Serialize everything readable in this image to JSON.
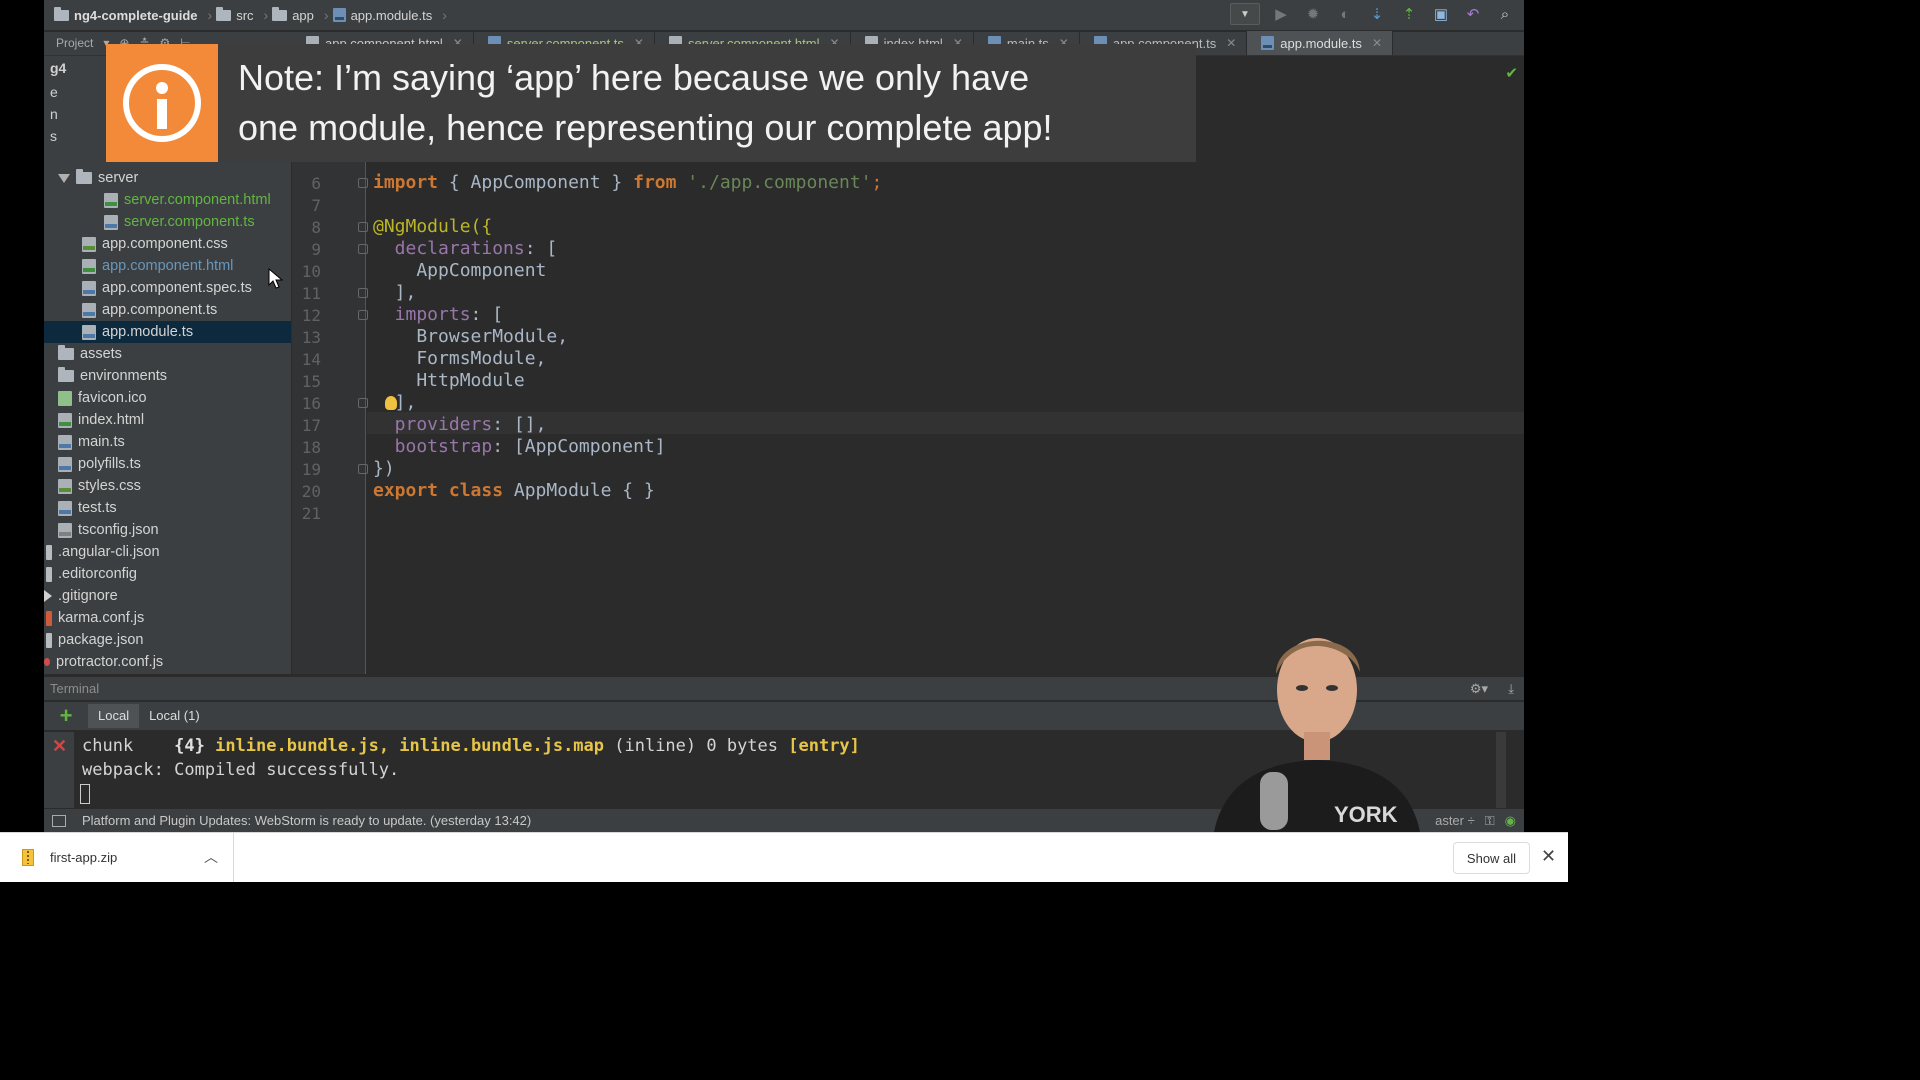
{
  "breadcrumb": {
    "items": [
      "ng4-complete-guide",
      "src",
      "app",
      "app.module.ts"
    ]
  },
  "project_panel": {
    "title": "Project"
  },
  "tabs": [
    {
      "label": "app.component.html",
      "active": false
    },
    {
      "label": "server.component.ts",
      "active": false
    },
    {
      "label": "server.component.html",
      "active": false
    },
    {
      "label": "index.html",
      "active": false
    },
    {
      "label": "main.ts",
      "active": false
    },
    {
      "label": "app.component.ts",
      "active": false
    },
    {
      "label": "app.module.ts",
      "active": true
    }
  ],
  "tree": {
    "server_folder": "server",
    "files": [
      "server.component.html",
      "server.component.ts",
      "app.component.css",
      "app.component.html",
      "app.component.spec.ts",
      "app.component.ts",
      "app.module.ts",
      "assets",
      "environments",
      "favicon.ico",
      "index.html",
      "main.ts",
      "polyfills.ts",
      "styles.css",
      "test.ts",
      "tsconfig.json",
      ".angular-cli.json",
      ".editorconfig",
      ".gitignore",
      "karma.conf.js",
      "package.json",
      "protractor.conf.js"
    ],
    "partial_root_label": "g4",
    "partial_letters": [
      "e",
      "n",
      "s"
    ]
  },
  "editor": {
    "line_numbers": [
      "6",
      "7",
      "8",
      "9",
      "10",
      "11",
      "12",
      "13",
      "14",
      "15",
      "16",
      "17",
      "18",
      "19",
      "20",
      "21"
    ],
    "code": {
      "l6_import": "import",
      "l6_mid": " { AppComponent } ",
      "l6_from": "from",
      "l6_str": " './app.component'",
      "l6_end": ";",
      "l8": "@NgModule({",
      "l9_prop": "  declarations",
      "l9_rest": ": [",
      "l10": "    AppComponent",
      "l11": "  ],",
      "l12_prop": "  imports",
      "l12_rest": ": [",
      "l13": "    BrowserModule,",
      "l14": "    FormsModule,",
      "l15": "    HttpModule",
      "l16": "  ],",
      "l17_prop": "  providers",
      "l17_rest": ": [],",
      "l18_prop": "  bootstrap",
      "l18_rest": ": [AppComponent]",
      "l19": "})",
      "l20_kw": "export class",
      "l20_rest": " AppModule { }"
    }
  },
  "note": {
    "text_line1": "Note: I’m saying ‘app’ here because we only have",
    "text_line2": "one module, hence representing our complete app!",
    "icon": "info-icon",
    "accent": "#f38a3a"
  },
  "terminal": {
    "title": "Terminal",
    "tabs": [
      "Local",
      "Local (1)"
    ],
    "line1_a": "chunk    ",
    "line1_b": "{4}",
    "line1_c": " inline.bundle.js, inline.bundle.js.map",
    "line1_d": " (inline) 0 bytes ",
    "line1_e": "[entry]",
    "line2": "webpack: Compiled successfully."
  },
  "status": {
    "message": "Platform and Plugin Updates: WebStorm is ready to update. (yesterday 13:42)",
    "branch": "aster ÷"
  },
  "downloads": {
    "file_name": "first-app.zip",
    "show_all": "Show all"
  }
}
